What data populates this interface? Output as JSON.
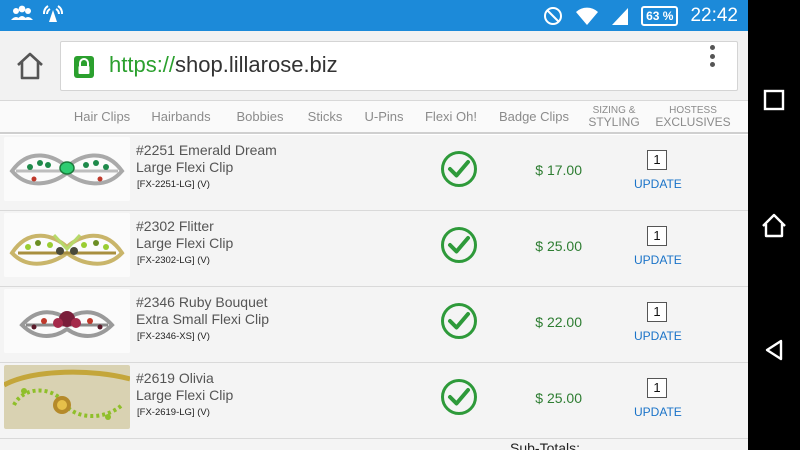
{
  "status_bar": {
    "battery": "63 %",
    "time": "22:42",
    "left_icons": [
      "people-icon",
      "signal-broadcast-icon"
    ],
    "right_icons": [
      "do-not-disturb-icon",
      "wifi-icon",
      "cell-signal-icon",
      "battery-icon"
    ]
  },
  "browser": {
    "url_scheme": "https://",
    "url_host": "shop.lillarose.biz",
    "scheme_color": "#2ba02e"
  },
  "categories": [
    {
      "label": "Hair Clips"
    },
    {
      "label": "Hairbands"
    },
    {
      "label": "Bobbies"
    },
    {
      "label": "Sticks"
    },
    {
      "label": "U-Pins"
    },
    {
      "label": "Flexi Oh!"
    },
    {
      "label": "Badge Clips"
    },
    {
      "label_line1": "SIZING &",
      "label_line2": "STYLING"
    },
    {
      "label_line1": "HOSTESS",
      "label_line2": "EXCLUSIVES"
    }
  ],
  "items": [
    {
      "name": "#2251 Emerald Dream",
      "type": "Large Flexi Clip",
      "sku": "[FX-2251-LG] (V)",
      "price": "$ 17.00",
      "qty": "1",
      "update_label": "UPDATE"
    },
    {
      "name": "#2302 Flitter",
      "type": "Large Flexi Clip",
      "sku": "[FX-2302-LG] (V)",
      "price": "$ 25.00",
      "qty": "1",
      "update_label": "UPDATE"
    },
    {
      "name": "#2346 Ruby Bouquet",
      "type": "Extra Small Flexi Clip",
      "sku": "[FX-2346-XS] (V)",
      "price": "$ 22.00",
      "qty": "1",
      "update_label": "UPDATE"
    },
    {
      "name": "#2619 Olivia",
      "type": "Large Flexi Clip",
      "sku": "[FX-2619-LG] (V)",
      "price": "$ 25.00",
      "qty": "1",
      "update_label": "UPDATE"
    }
  ],
  "subtotals_label": "Sub-Totals:",
  "colors": {
    "status_bar": "#1c8ad9",
    "price": "#2e7d32",
    "check": "#2e9a3a",
    "link": "#1a73c8"
  }
}
